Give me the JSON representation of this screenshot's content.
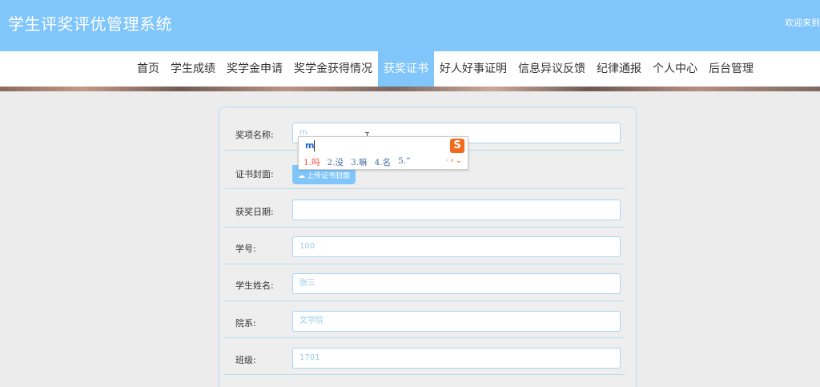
{
  "header": {
    "app_title": "学生评奖评优管理系统",
    "welcome_text": "欢迎来到"
  },
  "nav": {
    "items": [
      {
        "label": "首页"
      },
      {
        "label": "学生成绩"
      },
      {
        "label": "奖学金申请"
      },
      {
        "label": "奖学金获得情况"
      },
      {
        "label": "获奖证书",
        "active": true
      },
      {
        "label": "好人好事证明"
      },
      {
        "label": "信息异议反馈"
      },
      {
        "label": "纪律通报"
      },
      {
        "label": "个人中心"
      },
      {
        "label": "后台管理"
      }
    ]
  },
  "form": {
    "award_name": {
      "label": "奖项名称:",
      "value": "m"
    },
    "cover": {
      "label": "证书封面:",
      "button_label": "上传证书封面"
    },
    "award_date": {
      "label": "获奖日期:",
      "placeholder": ""
    },
    "student_id": {
      "label": "学号:",
      "placeholder": "100"
    },
    "student_name": {
      "label": "学生姓名:",
      "placeholder": "张三"
    },
    "department": {
      "label": "院系:",
      "placeholder": "文学院"
    },
    "class": {
      "label": "班级:",
      "placeholder": "1701"
    }
  },
  "ime": {
    "composition": "m",
    "logo_letter": "S",
    "candidates": [
      "1.吗",
      "2.没",
      "3.嘛",
      "4.名",
      "5.”"
    ],
    "arrows": {
      "prev": "‹",
      "next": "›",
      "expand": "⌄"
    }
  },
  "colors": {
    "primary": "#80c6fb",
    "page_bg": "#ececec",
    "ime_accent": "#f26a1b",
    "first_candidate": "#e8473a"
  }
}
